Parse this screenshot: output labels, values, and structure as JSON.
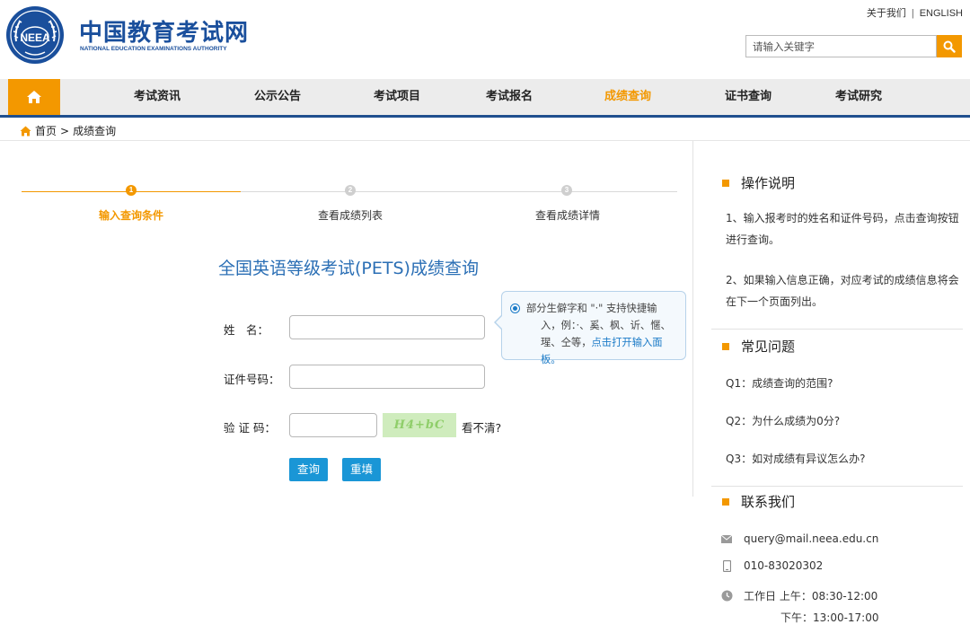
{
  "header": {
    "logo_seal_text": "NEEA",
    "logo_cn": "中国教育考试网",
    "logo_en": "NATIONAL EDUCATION EXAMINATIONS AUTHORITY",
    "about_label": "关于我们",
    "separator": "|",
    "english_label": "ENGLISH",
    "search_placeholder": "请输入关键字"
  },
  "nav": {
    "items": [
      {
        "label": "考试资讯"
      },
      {
        "label": "公示公告"
      },
      {
        "label": "考试项目"
      },
      {
        "label": "考试报名"
      },
      {
        "label": "成绩查询",
        "active": true
      },
      {
        "label": "证书查询"
      },
      {
        "label": "考试研究"
      }
    ]
  },
  "breadcrumb": {
    "home": "首页",
    "separator": ">",
    "current": "成绩查询"
  },
  "steps": [
    {
      "num": "1",
      "label": "输入查询条件",
      "active": true
    },
    {
      "num": "2",
      "label": "查看成绩列表",
      "active": false
    },
    {
      "num": "3",
      "label": "查看成绩详情",
      "active": false
    }
  ],
  "form": {
    "title": "全国英语等级考试(PETS)成绩查询",
    "name_label": "姓　名：",
    "id_label": "证件号码：",
    "captcha_label": "验 证 码：",
    "captcha_image_text": "H4+bC",
    "refresh_label": "看不清?",
    "query_button": "查询",
    "reset_button": "重填",
    "tooltip_line1": "部分生僻字和 \"·\" 支持快捷输",
    "tooltip_line2": "入，例：·、奚、枫、䜣、㥾、",
    "tooltip_line3_prefix": "瑆、仝等，",
    "tooltip_link": "点击打开输入面板。"
  },
  "sidebar": {
    "instructions_title": "操作说明",
    "instructions": [
      "1、输入报考时的姓名和证件号码，点击查询按钮进行查询。",
      "2、如果输入信息正确，对应考试的成绩信息将会在下一个页面列出。"
    ],
    "faq_title": "常见问题",
    "faq": [
      "Q1：成绩查询的范围?",
      "Q2：为什么成绩为0分?",
      "Q3：如对成绩有异议怎么办?"
    ],
    "contact_title": "联系我们",
    "email": "query@mail.neea.edu.cn",
    "phone": "010-83020302",
    "hours_label": "工作日 上午：08:30-12:00",
    "hours_pm": "下午：13:00-17:00"
  },
  "colors": {
    "brand_blue": "#1a4f9c",
    "accent_orange": "#f39800",
    "title_blue": "#2b6fb5",
    "button_blue": "#1a96d6"
  }
}
